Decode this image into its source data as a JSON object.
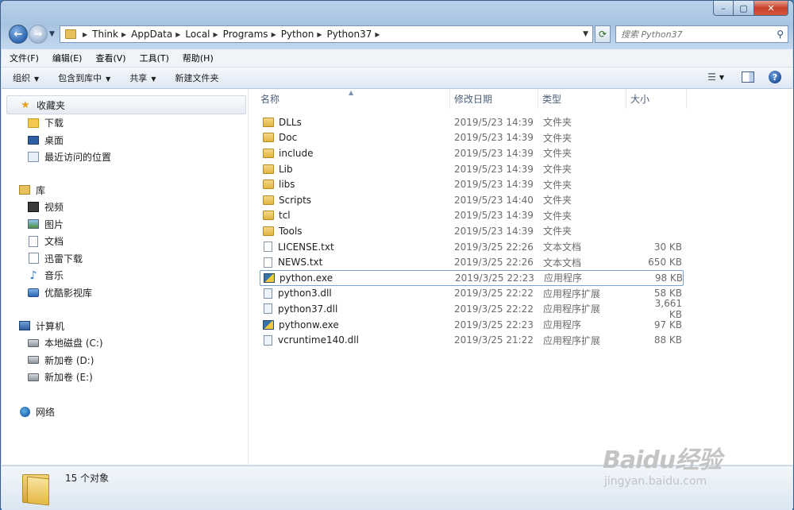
{
  "window": {
    "min": "–",
    "max": "▢",
    "close": "✕"
  },
  "breadcrumb": [
    "Think",
    "AppData",
    "Local",
    "Programs",
    "Python",
    "Python37"
  ],
  "search": {
    "placeholder": "搜索 Python37"
  },
  "menu": [
    "文件(F)",
    "编辑(E)",
    "查看(V)",
    "工具(T)",
    "帮助(H)"
  ],
  "commands": {
    "organize": "组织",
    "include_in_library": "包含到库中",
    "share": "共享",
    "new_folder": "新建文件夹"
  },
  "nav": {
    "favorites": {
      "label": "收藏夹",
      "items": [
        "下载",
        "桌面",
        "最近访问的位置"
      ]
    },
    "libraries": {
      "label": "库",
      "items": [
        "视频",
        "图片",
        "文档",
        "迅雷下载",
        "音乐",
        "优酷影视库"
      ]
    },
    "computer": {
      "label": "计算机",
      "items": [
        "本地磁盘 (C:)",
        "新加卷 (D:)",
        "新加卷 (E:)"
      ]
    },
    "network": {
      "label": "网络"
    }
  },
  "columns": {
    "name": "名称",
    "date": "修改日期",
    "type": "类型",
    "size": "大小"
  },
  "files": [
    {
      "name": "DLLs",
      "date": "2019/5/23 14:39",
      "type": "文件夹",
      "size": "",
      "kind": "folder"
    },
    {
      "name": "Doc",
      "date": "2019/5/23 14:39",
      "type": "文件夹",
      "size": "",
      "kind": "folder"
    },
    {
      "name": "include",
      "date": "2019/5/23 14:39",
      "type": "文件夹",
      "size": "",
      "kind": "folder"
    },
    {
      "name": "Lib",
      "date": "2019/5/23 14:39",
      "type": "文件夹",
      "size": "",
      "kind": "folder"
    },
    {
      "name": "libs",
      "date": "2019/5/23 14:39",
      "type": "文件夹",
      "size": "",
      "kind": "folder"
    },
    {
      "name": "Scripts",
      "date": "2019/5/23 14:40",
      "type": "文件夹",
      "size": "",
      "kind": "folder"
    },
    {
      "name": "tcl",
      "date": "2019/5/23 14:39",
      "type": "文件夹",
      "size": "",
      "kind": "folder"
    },
    {
      "name": "Tools",
      "date": "2019/5/23 14:39",
      "type": "文件夹",
      "size": "",
      "kind": "folder"
    },
    {
      "name": "LICENSE.txt",
      "date": "2019/3/25 22:26",
      "type": "文本文档",
      "size": "30 KB",
      "kind": "txt"
    },
    {
      "name": "NEWS.txt",
      "date": "2019/3/25 22:26",
      "type": "文本文档",
      "size": "650 KB",
      "kind": "txt"
    },
    {
      "name": "python.exe",
      "date": "2019/3/25 22:23",
      "type": "应用程序",
      "size": "98 KB",
      "kind": "exe",
      "selected": true
    },
    {
      "name": "python3.dll",
      "date": "2019/3/25 22:22",
      "type": "应用程序扩展",
      "size": "58 KB",
      "kind": "dll"
    },
    {
      "name": "python37.dll",
      "date": "2019/3/25 22:22",
      "type": "应用程序扩展",
      "size": "3,661 KB",
      "kind": "dll"
    },
    {
      "name": "pythonw.exe",
      "date": "2019/3/25 22:23",
      "type": "应用程序",
      "size": "97 KB",
      "kind": "exe"
    },
    {
      "name": "vcruntime140.dll",
      "date": "2019/3/25 21:22",
      "type": "应用程序扩展",
      "size": "88 KB",
      "kind": "dll"
    }
  ],
  "status": {
    "count": "15 个对象"
  },
  "watermark": {
    "main": "Baidu经验",
    "sub": "jingyan.baidu.com"
  }
}
